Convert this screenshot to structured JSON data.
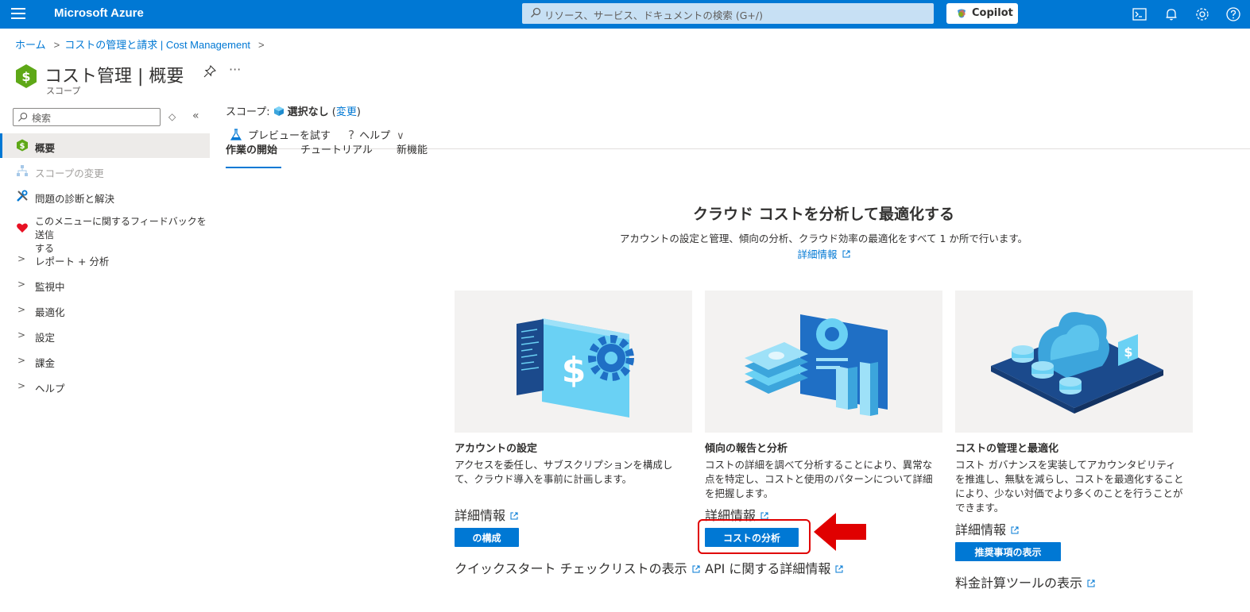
{
  "topbar": {
    "brand": "Microsoft Azure",
    "search_placeholder": "リソース、サービス、ドキュメントの検索 (G+/)",
    "copilot_label": "Copilot",
    "accent": "#0078d4"
  },
  "breadcrumb": {
    "home": "ホーム",
    "billing": "コストの管理と請求 | Cost Management"
  },
  "page": {
    "title": "コスト管理 | 概要",
    "subtitle": "スコープ",
    "more": "···"
  },
  "sidebar": {
    "search_placeholder": "検索",
    "items": [
      {
        "label": "概要",
        "icon": "dollar-hex-icon",
        "active": true
      },
      {
        "label": "スコープの変更",
        "icon": "hierarchy-icon",
        "disabled": true
      },
      {
        "label": "問題の診断と解決",
        "icon": "wrench-icon"
      },
      {
        "label": "このメニューに関するフィードバックを送信する",
        "line1": "このメニューに関するフィードバックを送信",
        "line2": "する",
        "icon": "heart-icon"
      },
      {
        "label": "レポート + 分析",
        "icon": "chevron-right-icon"
      },
      {
        "label": "監視中",
        "icon": "chevron-right-icon"
      },
      {
        "label": "最適化",
        "icon": "chevron-right-icon"
      },
      {
        "label": "設定",
        "icon": "chevron-right-icon"
      },
      {
        "label": "課金",
        "icon": "chevron-right-icon"
      },
      {
        "label": "ヘルプ",
        "icon": "chevron-right-icon"
      }
    ]
  },
  "scope": {
    "label": "スコープ:",
    "value": "選択なし",
    "change_open": "(",
    "change": "変更",
    "change_close": ")"
  },
  "commands": {
    "preview": "プレビューを試す",
    "help": "ヘルプ"
  },
  "tabs": [
    {
      "label": "作業の開始",
      "active": true
    },
    {
      "label": "チュートリアル"
    },
    {
      "label": "新機能"
    }
  ],
  "hero": {
    "title": "クラウド コストを分析して最適化する",
    "description": "アカウントの設定と管理、傾向の分析、クラウド効率の最適化をすべて 1 か所で行います。",
    "link": "詳細情報"
  },
  "cards": [
    {
      "title": "アカウントの設定",
      "description": "アクセスを委任し、サブスクリプションを構成して、クラウド導入を事前に計画します。",
      "desc_lines": [
        "アクセスを委任し、サブスクリプションを構成し",
        "て、クラウド導入を事前に計画します。"
      ],
      "link": "詳細情報",
      "button": "の構成",
      "footer_link": "クイックスタート チェックリストの表示"
    },
    {
      "title": "傾向の報告と分析",
      "description": "コストの詳細を調べて分析することにより、異常な点を特定し、コストと使用のパターンについて詳細を把握します。",
      "desc_lines": [
        "コストの詳細を調べて分析することにより、異常な",
        "点を特定し、コストと使用のパターンについて詳細",
        "を把握します。"
      ],
      "link": "詳細情報",
      "button": "コストの分析",
      "footer_link": "API に関する詳細情報"
    },
    {
      "title": "コストの管理と最適化",
      "description": "コスト ガバナンスを実装してアカウンタビリティを推進し、無駄を減らし、コストを最適化することにより、少ない対価でより多くのことを行うことができます。",
      "desc_lines": [
        "コスト ガバナンスを実装してアカウンタビリティ",
        "を推進し、無駄を減らし、コストを最適化すること",
        "により、少ない対価でより多くのことを行うことが",
        "できます。"
      ],
      "link": "詳細情報",
      "button": "推奨事項の表示",
      "footer_link": "料金計算ツールの表示"
    }
  ],
  "annotation": {
    "color": "#e00000"
  }
}
